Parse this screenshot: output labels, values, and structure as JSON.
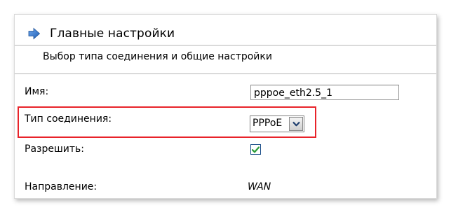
{
  "section": {
    "title": "Главные настройки",
    "subtitle": "Выбор типа соединения и общие настройки"
  },
  "fields": {
    "name": {
      "label": "Имя:",
      "value": "pppoe_eth2.5_1"
    },
    "connection_type": {
      "label": "Тип соединения:",
      "selected": "PPPoE"
    },
    "enable": {
      "label": "Разрешить:",
      "checked": true
    },
    "direction": {
      "label": "Направление:",
      "value": "WAN"
    }
  },
  "colors": {
    "highlight_border": "#e8232a",
    "icon_blue": "#2a6fc9",
    "check_green": "#2e9e3a"
  },
  "icons": {
    "title_icon": "arrow-right-icon",
    "select_arrow": "chevron-down-icon",
    "checkbox_mark": "checkmark-icon"
  }
}
